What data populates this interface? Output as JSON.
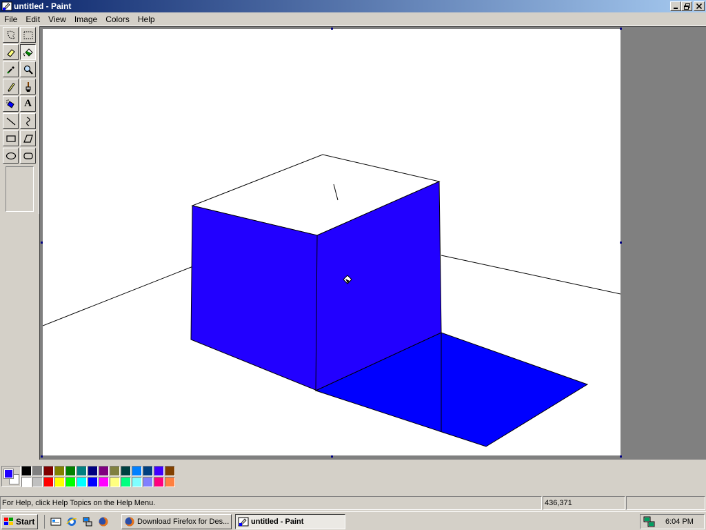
{
  "window": {
    "title": "untitled - Paint",
    "icon": "paint-app-icon",
    "controls": [
      "minimize",
      "restore",
      "close"
    ]
  },
  "menu": [
    "File",
    "Edit",
    "View",
    "Image",
    "Colors",
    "Help"
  ],
  "tools": [
    {
      "name": "free-form-select",
      "icon": "free-form-select-icon"
    },
    {
      "name": "select",
      "icon": "rect-select-icon"
    },
    {
      "name": "eraser",
      "icon": "eraser-icon"
    },
    {
      "name": "fill-with-color",
      "icon": "paint-bucket-icon",
      "active": true
    },
    {
      "name": "pick-color",
      "icon": "eyedropper-icon"
    },
    {
      "name": "magnifier",
      "icon": "magnifier-icon"
    },
    {
      "name": "pencil",
      "icon": "pencil-icon"
    },
    {
      "name": "brush",
      "icon": "brush-icon"
    },
    {
      "name": "airbrush",
      "icon": "airbrush-icon"
    },
    {
      "name": "text",
      "icon": "text-icon",
      "glyph": "A"
    },
    {
      "name": "line",
      "icon": "line-icon"
    },
    {
      "name": "curve",
      "icon": "curve-icon"
    },
    {
      "name": "rectangle",
      "icon": "rectangle-icon"
    },
    {
      "name": "polygon",
      "icon": "polygon-icon"
    },
    {
      "name": "ellipse",
      "icon": "ellipse-icon"
    },
    {
      "name": "rounded-rectangle",
      "icon": "rounded-rectangle-icon"
    }
  ],
  "colors": {
    "foreground": "#2000ff",
    "background": "#ffffff",
    "palette_top": [
      "#000000",
      "#808080",
      "#800000",
      "#808000",
      "#008000",
      "#008080",
      "#000080",
      "#800080",
      "#808040",
      "#004040",
      "#0080ff",
      "#004080",
      "#4000ff",
      "#804000"
    ],
    "palette_bottom": [
      "#ffffff",
      "#c0c0c0",
      "#ff0000",
      "#ffff00",
      "#00ff00",
      "#00ffff",
      "#0000ff",
      "#ff00ff",
      "#ffff80",
      "#00ff80",
      "#80ffff",
      "#8080ff",
      "#ff0080",
      "#ff8040"
    ],
    "cube_side": "#2200ff",
    "cube_shadow": "#0000ff"
  },
  "status": {
    "help_text": "For Help, click Help Topics on the Help Menu.",
    "coordinates": "436,371",
    "size": ""
  },
  "taskbar": {
    "start_label": "Start",
    "quick_launch": [
      "show-desktop-icon",
      "internet-explorer-icon",
      "network-icon",
      "firefox-icon"
    ],
    "tasks": [
      {
        "label": "Download Firefox for Des...",
        "icon": "firefox-icon",
        "active": false
      },
      {
        "label": "untitled - Paint",
        "icon": "paint-app-icon",
        "active": true
      }
    ],
    "clock": "6:04 PM",
    "tray_icons": [
      "network-tray-icon"
    ]
  }
}
